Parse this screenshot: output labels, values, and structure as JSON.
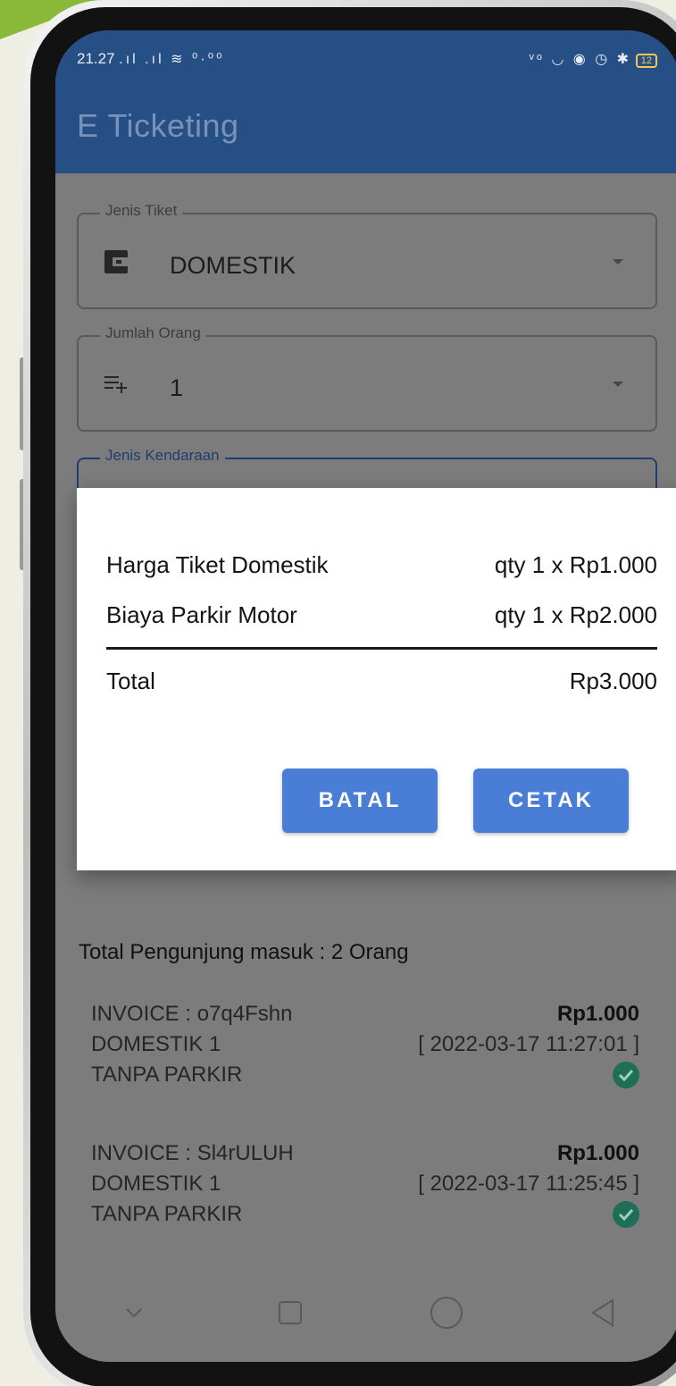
{
  "status_bar": {
    "time": "21.27",
    "left_icons": ".ıl .ıl ≋ ⁰·⁰⁰",
    "right_icons": "ᵛᵒ ◡ ◉ ◷ ✱",
    "battery": "12"
  },
  "app": {
    "title": "E Ticketing"
  },
  "form": {
    "ticket_type": {
      "label": "Jenis Tiket",
      "value": "DOMESTIK",
      "icon": "wallet-icon"
    },
    "people_count": {
      "label": "Jumlah Orang",
      "value": "1",
      "icon": "playlist-add-icon"
    },
    "vehicle_type": {
      "label": "Jenis Kendaraan"
    }
  },
  "dialog": {
    "items": [
      {
        "label": "Harga Tiket Domestik",
        "value": "qty 1 x Rp1.000"
      },
      {
        "label": "Biaya Parkir Motor",
        "value": "qty 1 x Rp2.000"
      }
    ],
    "total_label": "Total",
    "total_value": "Rp3.000",
    "cancel_label": "BATAL",
    "print_label": "CETAK",
    "button_color": "#4a7ed6"
  },
  "visitors": {
    "total_text": "Total Pengunjung masuk : 2 Orang"
  },
  "invoices": [
    {
      "invoice": "INVOICE : o7q4Fshn",
      "amount": "Rp1.000",
      "ticket": "DOMESTIK 1",
      "timestamp": "[ 2022-03-17 11:27:01 ]",
      "parking": "TANPA PARKIR",
      "status_icon": "check-circle-icon"
    },
    {
      "invoice": "INVOICE : Sl4rULUH",
      "amount": "Rp1.000",
      "ticket": "DOMESTIK 1",
      "timestamp": "[ 2022-03-17 11:25:45 ]",
      "parking": "TANPA PARKIR",
      "status_icon": "check-circle-icon"
    }
  ],
  "colors": {
    "app_bar": "#264f86",
    "accent": "#4a7ed6",
    "check": "#1f6f58",
    "background": "#efeee2",
    "triangle": "#8ab839"
  }
}
